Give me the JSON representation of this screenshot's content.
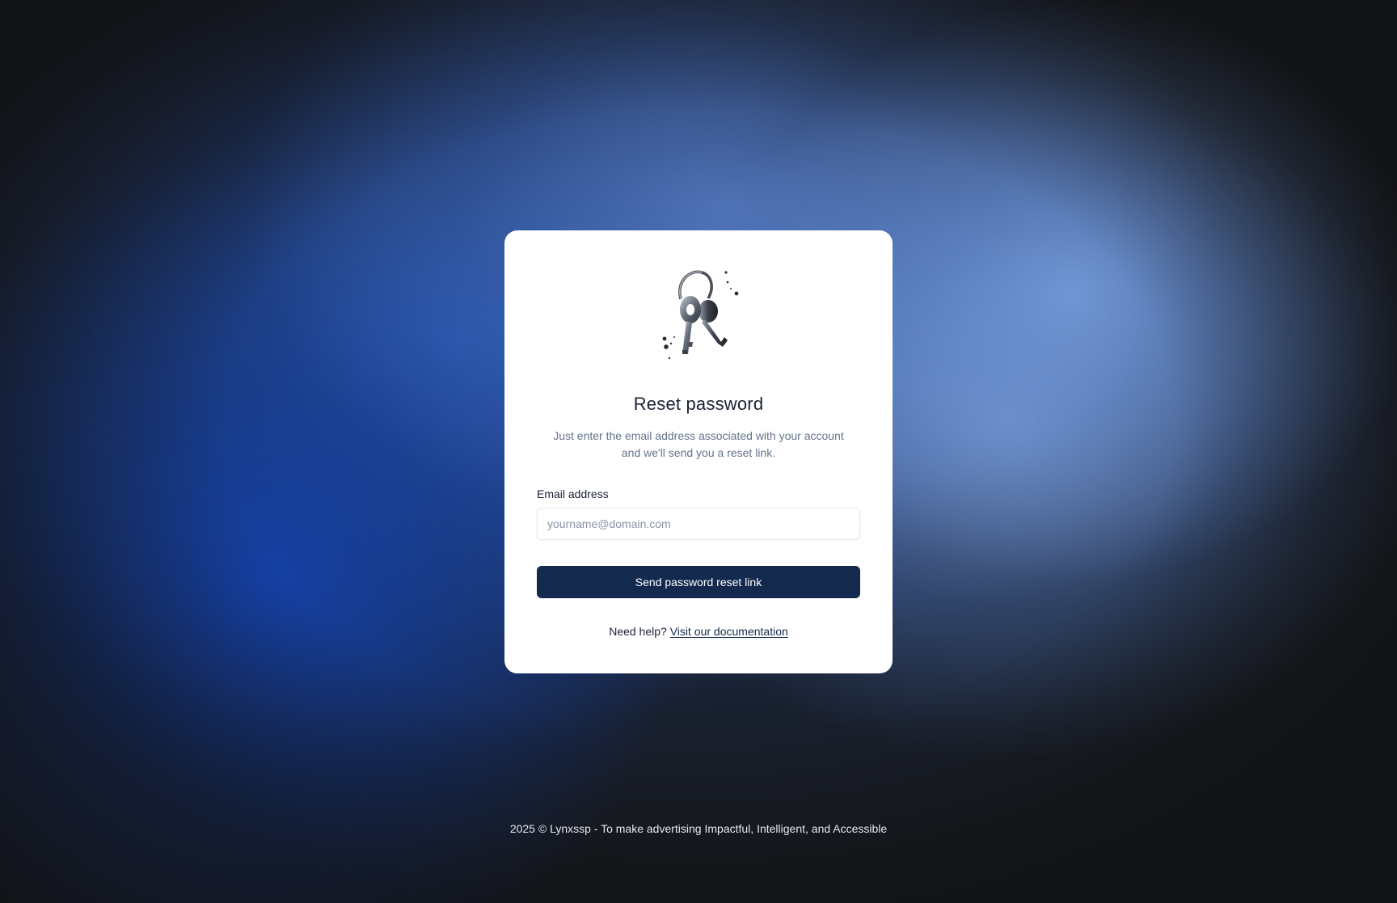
{
  "card": {
    "icon": "keys-icon",
    "title": "Reset password",
    "subtitle": "Just enter the email address associated with your account and we'll send you a reset link.",
    "email_label": "Email address",
    "email_placeholder": "yourname@domain.com",
    "email_value": "",
    "submit_label": "Send password reset link",
    "help_text": "Need help?",
    "help_link_label": "Visit our documentation"
  },
  "footer": {
    "text": "2025 © Lynxssp - To make advertising Impactful, Intelligent, and Accessible"
  },
  "colors": {
    "primary_button": "#132a4e",
    "card_background": "#ffffff",
    "page_background": "#17191d",
    "accent_blue": "#1f4fb3"
  }
}
